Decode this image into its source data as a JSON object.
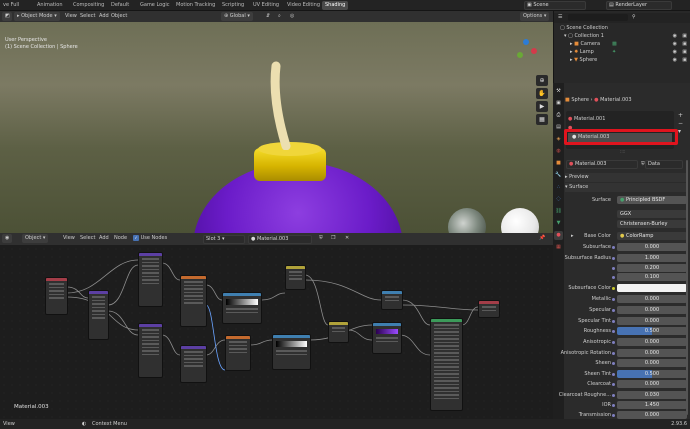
{
  "topbar": {
    "tabs": [
      "ve Full",
      "Animation",
      "Compositing",
      "Default",
      "Game Logic",
      "Motion Tracking",
      "Scripting",
      "UV Editing",
      "Video Editing",
      "Shading"
    ],
    "active_tab": "Shading",
    "scene": "Scene",
    "view_layer": "RenderLayer"
  },
  "viewport": {
    "mode": "Object Mode",
    "menus": [
      "View",
      "Select",
      "Add",
      "Object"
    ],
    "orientation": "Global",
    "options": "Options",
    "info_line1": "User Perspective",
    "info_line2": "(1) Scene Collection | Sphere"
  },
  "node_editor": {
    "type": "Object",
    "menus": [
      "View",
      "Select",
      "Add",
      "Node"
    ],
    "use_nodes_label": "Use Nodes",
    "use_nodes_checked": true,
    "slot": "Slot 3",
    "material": "Material.003",
    "material_label": "Material.003"
  },
  "outliner": {
    "root": "Scene Collection",
    "collection": "Collection 1",
    "items": [
      "Camera",
      "Lamp",
      "Sphere"
    ]
  },
  "properties": {
    "object_name": "Sphere",
    "material_name": "Material.003",
    "slots": [
      "Material.001",
      "",
      "Material.003"
    ],
    "selected_slot": "Material.003",
    "data_link": "Data",
    "sections": {
      "preview": "Preview",
      "surface": "Surface"
    },
    "surface_shader": "Principled BSDF",
    "distribution": "GGX",
    "subsurface_method": "Christensen-Burley",
    "base_color_label": "Base Color",
    "base_color_value": "ColorRamp",
    "rows": [
      {
        "label": "Subsurface",
        "value": "0.000",
        "style": "plain"
      },
      {
        "label": "Subsurface Radius",
        "value": "1.000",
        "style": "plain"
      },
      {
        "label": "",
        "value": "0.200",
        "style": "plain"
      },
      {
        "label": "",
        "value": "0.100",
        "style": "plain"
      },
      {
        "label": "Subsurface Color",
        "value": "",
        "style": "color"
      },
      {
        "label": "Metallic",
        "value": "0.000",
        "style": "plain"
      },
      {
        "label": "Specular",
        "value": "0.000",
        "style": "plain"
      },
      {
        "label": "Specular Tint",
        "value": "0.000",
        "style": "plain"
      },
      {
        "label": "Roughness",
        "value": "0.500",
        "style": "slider"
      },
      {
        "label": "Anisotropic",
        "value": "0.000",
        "style": "plain"
      },
      {
        "label": "Anisotropic Rotation",
        "value": "0.000",
        "style": "plain"
      },
      {
        "label": "Sheen",
        "value": "0.000",
        "style": "plain"
      },
      {
        "label": "Sheen Tint",
        "value": "0.500",
        "style": "slider"
      },
      {
        "label": "Clearcoat",
        "value": "0.000",
        "style": "plain"
      },
      {
        "label": "Clearcoat Roughne...",
        "value": "0.030",
        "style": "plain"
      },
      {
        "label": "IOR",
        "value": "1.450",
        "style": "plain"
      },
      {
        "label": "Transmission",
        "value": "0.000",
        "style": "plain"
      }
    ]
  },
  "statusbar": {
    "left": "View",
    "context": "Context Menu",
    "version": "2.93.6"
  },
  "colors": {
    "accent": "#4772b3",
    "highlight": "#e0141e",
    "active_tab": "#4a4a4a"
  }
}
